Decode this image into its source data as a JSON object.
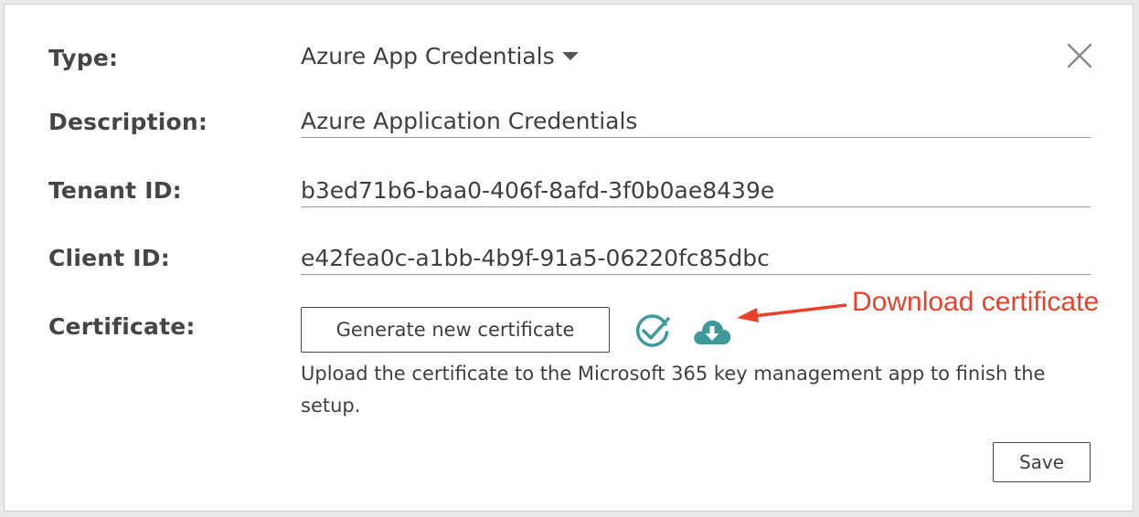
{
  "dialog": {
    "fields": {
      "type": {
        "label": "Type:",
        "value": "Azure App Credentials"
      },
      "description": {
        "label": "Description:",
        "value": "Azure Application Credentials"
      },
      "tenant_id": {
        "label": "Tenant ID:",
        "value": "b3ed71b6-baa0-406f-8afd-3f0b0ae8439e"
      },
      "client_id": {
        "label": "Client ID:",
        "value": "e42fea0c-a1bb-4b9f-91a5-06220fc85dbc"
      },
      "certificate": {
        "label": "Certificate:"
      }
    },
    "generate_button_label": "Generate new certificate",
    "help_text": "Upload the certificate to the Microsoft 365 key management app to finish the setup.",
    "save_label": "Save",
    "icons": {
      "close": "close-icon",
      "status": "check-circle-icon",
      "download": "cloud-download-icon"
    }
  },
  "annotation": {
    "text": "Download certificate",
    "color": "#e8412a"
  },
  "colors": {
    "accent": "#3e9a99"
  }
}
